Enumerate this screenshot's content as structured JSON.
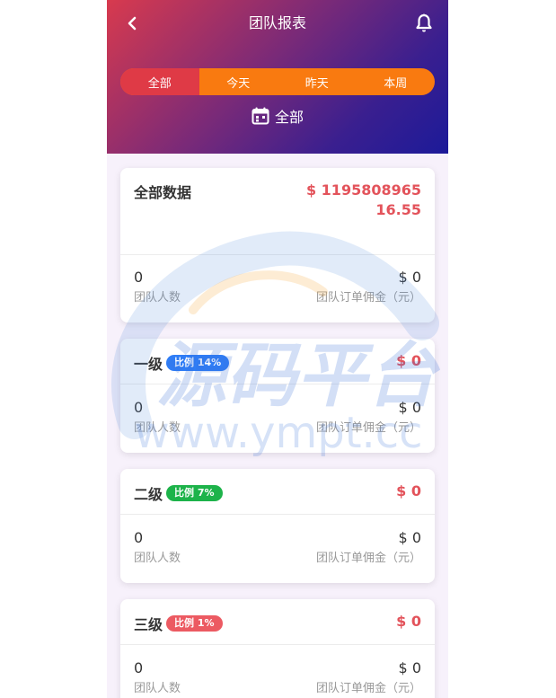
{
  "header": {
    "title": "团队报表",
    "tabs": [
      {
        "label": "全部",
        "active": true
      },
      {
        "label": "今天",
        "active": false
      },
      {
        "label": "昨天",
        "active": false
      },
      {
        "label": "本周",
        "active": false
      }
    ],
    "date_label": "全部"
  },
  "cards": {
    "all": {
      "title": "全部数据",
      "amount": "$ 119580896516.55",
      "members_value": "0",
      "members_label": "团队人数",
      "commission_value": "$ 0",
      "commission_label": "团队订单佣金（元）"
    },
    "level1": {
      "title": "一级",
      "badge": "比例 14%",
      "badge_color": "#2f7df6",
      "amount": "$ 0",
      "members_value": "0",
      "members_label": "团队人数",
      "commission_value": "$ 0",
      "commission_label": "团队订单佣金（元）"
    },
    "level2": {
      "title": "二级",
      "badge": "比例 7%",
      "badge_color": "#1db34a",
      "amount": "$ 0",
      "members_value": "0",
      "members_label": "团队人数",
      "commission_value": "$ 0",
      "commission_label": "团队订单佣金（元）"
    },
    "level3": {
      "title": "三级",
      "badge": "比例 1%",
      "badge_color": "#ec5a62",
      "amount": "$ 0",
      "members_value": "0",
      "members_label": "团队人数",
      "commission_value": "$ 0",
      "commission_label": "团队订单佣金（元）"
    }
  },
  "watermark": {
    "text": "源码平台",
    "url": "www.ympt.cc"
  },
  "colors": {
    "accent_red": "#e3535b",
    "tab_orange": "#f97a10",
    "tab_active": "#df3a46"
  }
}
